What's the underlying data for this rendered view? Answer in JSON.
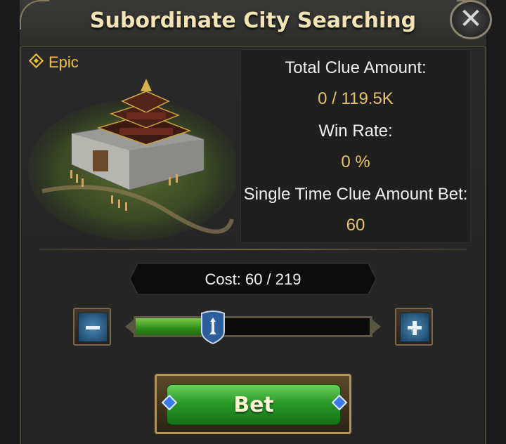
{
  "dialog": {
    "title": "Subordinate City Searching",
    "close_glyph": "✕"
  },
  "item": {
    "rarity": "Epic"
  },
  "info": {
    "total_clue_label": "Total Clue Amount:",
    "total_clue_value": "0 / 119.5K",
    "win_rate_label": "Win Rate:",
    "win_rate_value": "0 %",
    "single_bet_label": "Single Time Clue Amount Bet:",
    "single_bet_value": "60"
  },
  "cost": {
    "text": "Cost: 60 / 219",
    "current": 60,
    "max": 219
  },
  "slider": {
    "fraction": 0.33
  },
  "actions": {
    "bet_label": "Bet"
  },
  "colors": {
    "accent_gold": "#e5c26d",
    "rarity_yellow": "#f1c232",
    "bet_green": "#2a9a28"
  },
  "icons": {
    "close": "close-icon",
    "minus": "minus-icon",
    "plus": "plus-icon",
    "thumb": "slider-thumb-icon",
    "rarity": "diamond-icon"
  }
}
